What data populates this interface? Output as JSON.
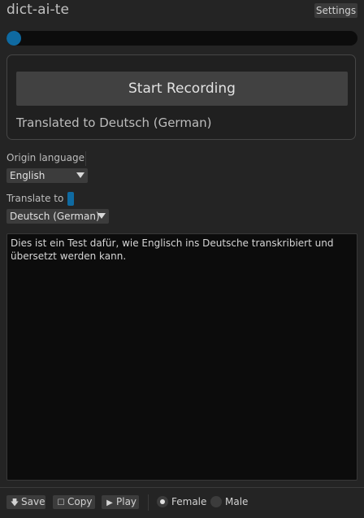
{
  "app": {
    "title": "dict-ai-te",
    "settings_label": "Settings"
  },
  "recording": {
    "level": 0.02,
    "accent_color": "#0f6aa1",
    "start_label": "Start Recording",
    "status": "Translated to Deutsch (German)"
  },
  "origin": {
    "label": "Origin language",
    "selected": "English"
  },
  "target": {
    "label": "Translate to",
    "selected": "Deutsch (German)"
  },
  "output": {
    "text": "Dies ist ein Test dafür, wie Englisch ins Deutsche transkribiert und übersetzt werden kann."
  },
  "bottom": {
    "save_label": "Save",
    "copy_label": "Copy",
    "play_label": "Play",
    "save_icon": "download-arrow-icon",
    "copy_icon": "copy-icon",
    "play_icon": "play-icon",
    "voice_options": [
      {
        "label": "Female",
        "selected": true
      },
      {
        "label": "Male",
        "selected": false
      }
    ]
  }
}
